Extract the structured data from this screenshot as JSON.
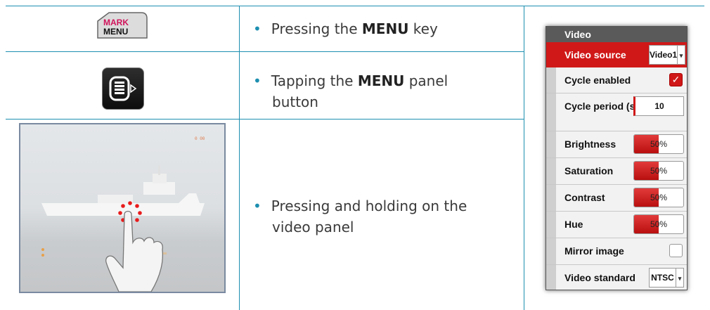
{
  "rows": [
    {
      "icon": "mark-menu-key-icon",
      "prefix": "Pressing the ",
      "bold": "MENU",
      "suffix": " key"
    },
    {
      "icon": "menu-panel-button-icon",
      "prefix": "Tapping the ",
      "bold": "MENU",
      "suffix": " panel",
      "line2": "button"
    },
    {
      "icon": "video-panel-press-hold-image",
      "line1": "Pressing and holding on the",
      "line2": "video panel"
    }
  ],
  "mark_key": {
    "top": "MARK",
    "bottom": "MENU"
  },
  "menu": {
    "title": "Video",
    "accent": "#d01818",
    "items": [
      {
        "label": "Video source",
        "value": "Video1",
        "selected": true
      },
      {
        "label": "Cycle enabled",
        "checked": true
      },
      {
        "label": "Cycle period (s)",
        "value": "10"
      },
      {
        "label": "Brightness",
        "value": "50%",
        "level": 0.5
      },
      {
        "label": "Saturation",
        "value": "50%",
        "level": 0.5
      },
      {
        "label": "Contrast",
        "value": "50%",
        "level": 0.5
      },
      {
        "label": "Hue",
        "value": "50%",
        "level": 0.5
      },
      {
        "label": "Mirror image",
        "checked": false
      },
      {
        "label": "Video standard",
        "value": "NTSC"
      }
    ]
  }
}
